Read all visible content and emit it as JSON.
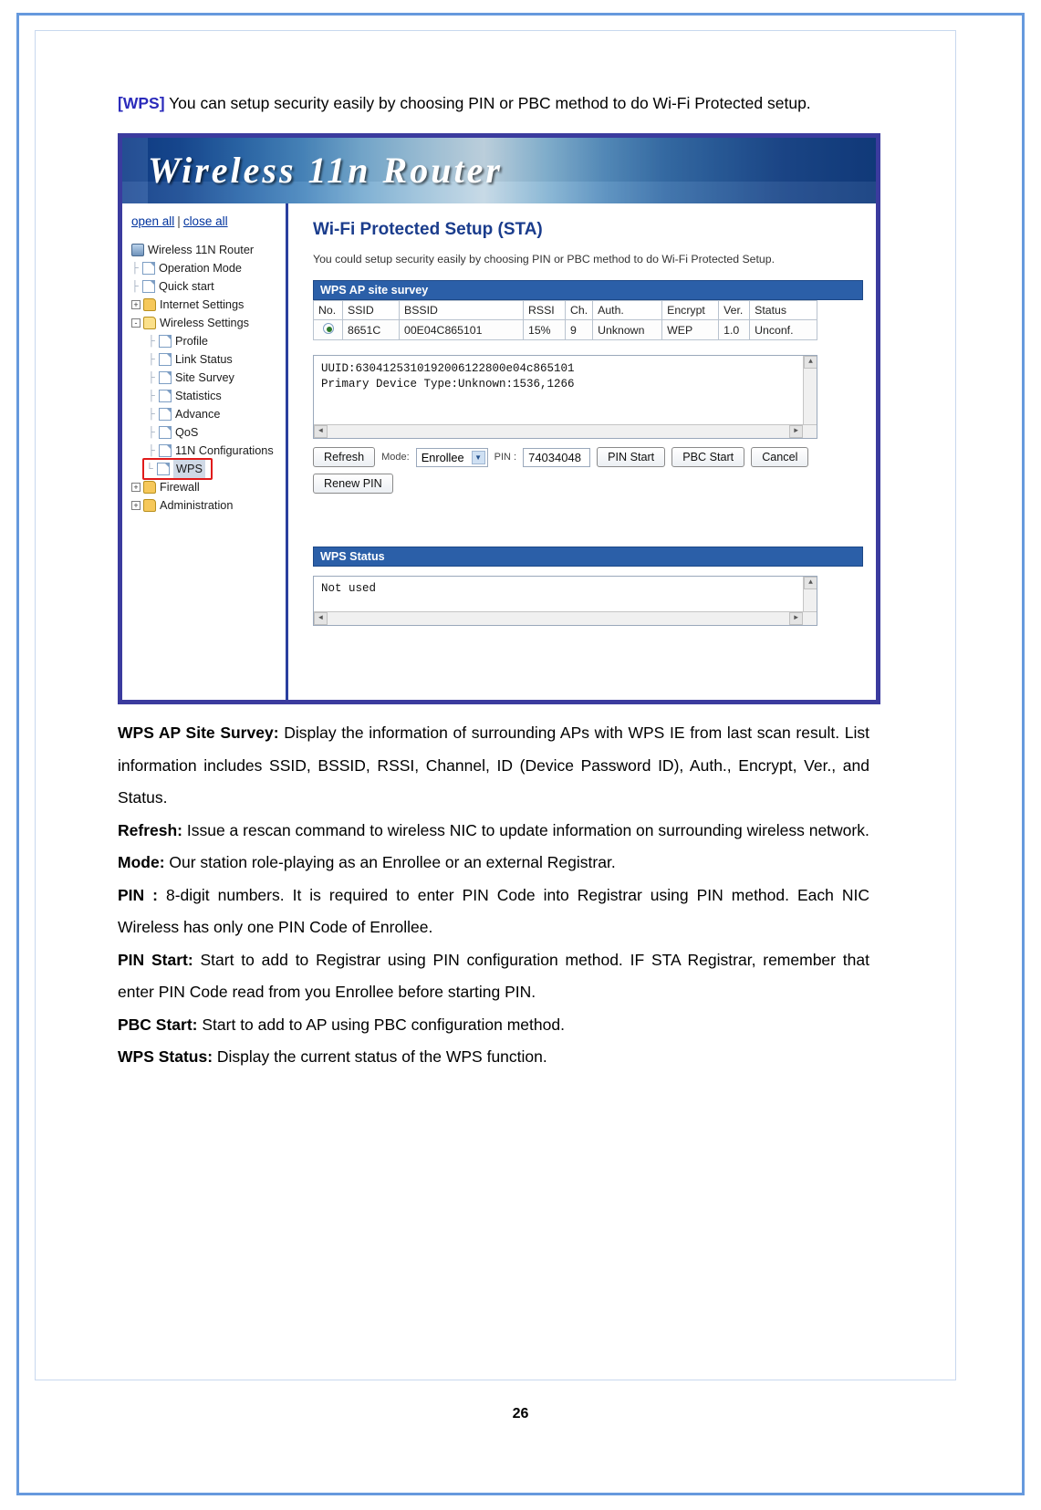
{
  "document": {
    "page_number": "26",
    "intro": {
      "tag": "[WPS]",
      "text": " You can setup security easily by choosing PIN or PBC method to do Wi-Fi Protected setup."
    }
  },
  "router_ui": {
    "banner_title": "Wireless 11n Router",
    "nav": {
      "open_all": "open all",
      "separator": "|",
      "close_all": "close all",
      "tree": [
        {
          "label": "Wireless 11N Router",
          "icon": "computer-icon",
          "level": 0,
          "toggle": ""
        },
        {
          "label": "Operation Mode",
          "icon": "page-icon",
          "level": 1,
          "toggle": ""
        },
        {
          "label": "Quick start",
          "icon": "page-icon",
          "level": 1,
          "toggle": ""
        },
        {
          "label": "Internet Settings",
          "icon": "folder-icon",
          "level": 1,
          "toggle": "+"
        },
        {
          "label": "Wireless Settings",
          "icon": "folder-open-icon",
          "level": 1,
          "toggle": "-"
        },
        {
          "label": "Profile",
          "icon": "page-icon",
          "level": 2,
          "toggle": ""
        },
        {
          "label": "Link Status",
          "icon": "page-icon",
          "level": 2,
          "toggle": ""
        },
        {
          "label": "Site Survey",
          "icon": "page-icon",
          "level": 2,
          "toggle": ""
        },
        {
          "label": "Statistics",
          "icon": "page-icon",
          "level": 2,
          "toggle": ""
        },
        {
          "label": "Advance",
          "icon": "page-icon",
          "level": 2,
          "toggle": ""
        },
        {
          "label": "QoS",
          "icon": "page-icon",
          "level": 2,
          "toggle": ""
        },
        {
          "label": "11N Configurations",
          "icon": "page-icon",
          "level": 2,
          "toggle": ""
        },
        {
          "label": "WPS",
          "icon": "page-icon",
          "level": 2,
          "toggle": "",
          "selected": true
        },
        {
          "label": "Firewall",
          "icon": "folder-icon",
          "level": 1,
          "toggle": "+"
        },
        {
          "label": "Administration",
          "icon": "folder-icon",
          "level": 1,
          "toggle": "+"
        }
      ]
    },
    "main": {
      "title": "Wi-Fi Protected Setup (STA)",
      "subtitle": "You could setup security easily by choosing PIN or PBC method to do Wi-Fi Protected Setup.",
      "survey": {
        "heading": "WPS AP site survey",
        "columns": [
          "No.",
          "SSID",
          "BSSID",
          "RSSI",
          "Ch.",
          "Auth.",
          "Encrypt",
          "Ver.",
          "Status"
        ],
        "rows": [
          {
            "no": "",
            "ssid": "8651C",
            "bssid": "00E04C865101",
            "rssi": "15%",
            "ch": "9",
            "auth": "Unknown",
            "encrypt": "WEP",
            "ver": "1.0",
            "status": "Unconf."
          }
        ]
      },
      "info_box": {
        "line1": "UUID:6304125310192006122800e04c865101",
        "line2": "Primary Device Type:Unknown:1536,1266"
      },
      "controls": {
        "refresh": "Refresh",
        "mode_label": "Mode:",
        "mode_value": "Enrollee",
        "pin_label": "PIN :",
        "pin_value": "74034048",
        "pin_start": "PIN Start",
        "pbc_start": "PBC Start",
        "cancel": "Cancel",
        "renew_pin": "Renew PIN"
      },
      "status": {
        "heading": "WPS Status",
        "value": "Not used"
      }
    }
  },
  "descriptions": [
    {
      "term": "WPS AP Site Survey:",
      "body": " Display the information of surrounding APs with WPS IE from last scan result. List information includes SSID, BSSID, RSSI, Channel, ID (Device Password ID), Auth., Encrypt, Ver., and Status."
    },
    {
      "term": "Refresh:",
      "body": " Issue a rescan command to wireless NIC to update information on surrounding wireless network."
    },
    {
      "term": "Mode:",
      "body": " Our station role-playing as an Enrollee or an external Registrar."
    },
    {
      "term": "PIN :",
      "body": " 8-digit numbers. It is required to enter PIN Code into Registrar using PIN method. Each NIC Wireless has only one PIN Code of Enrollee."
    },
    {
      "term": "PIN Start:",
      "body": " Start to add to Registrar using PIN configuration method. IF STA Registrar, remember that enter PIN Code read from you Enrollee before starting PIN."
    },
    {
      "term": "PBC Start:",
      "body": " Start to add to AP using PBC configuration method."
    },
    {
      "term": "WPS Status:",
      "body": " Display the current status of the WPS function."
    }
  ]
}
